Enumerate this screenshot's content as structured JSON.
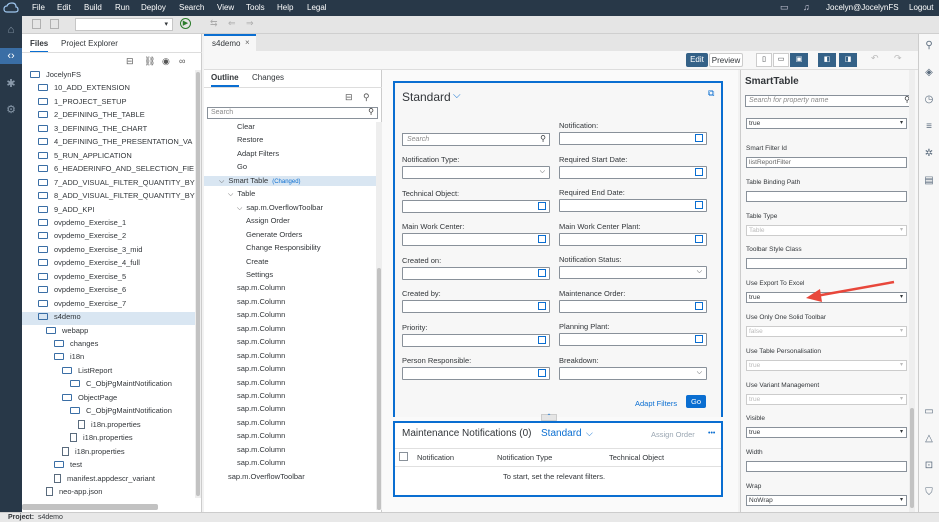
{
  "menubar": {
    "items": [
      "File",
      "Edit",
      "Build",
      "Run",
      "Deploy",
      "Search",
      "View",
      "Tools",
      "Help",
      "Legal"
    ],
    "user": "Jocelyn@JocelynFS",
    "logout": "Logout"
  },
  "files_panel": {
    "tabs": [
      "Files",
      "Project Explorer"
    ],
    "tree": [
      {
        "label": "JocelynFS",
        "level": 0,
        "kind": "folder"
      },
      {
        "label": "10_ADD_EXTENSION",
        "level": 1,
        "kind": "folder"
      },
      {
        "label": "1_PROJECT_SETUP",
        "level": 1,
        "kind": "folder"
      },
      {
        "label": "2_DEFINING_THE_TABLE",
        "level": 1,
        "kind": "folder"
      },
      {
        "label": "3_DEFINING_THE_CHART",
        "level": 1,
        "kind": "folder"
      },
      {
        "label": "4_DEFINING_THE_PRESENTATION_VA",
        "level": 1,
        "kind": "folder"
      },
      {
        "label": "5_RUN_APPLICATION",
        "level": 1,
        "kind": "folder"
      },
      {
        "label": "6_HEADERINFO_AND_SELECTION_FIE",
        "level": 1,
        "kind": "folder"
      },
      {
        "label": "7_ADD_VISUAL_FILTER_QUANTITY_BY",
        "level": 1,
        "kind": "folder"
      },
      {
        "label": "8_ADD_VISUAL_FILTER_QUANTITY_BY",
        "level": 1,
        "kind": "folder"
      },
      {
        "label": "9_ADD_KPI",
        "level": 1,
        "kind": "folder"
      },
      {
        "label": "ovpdemo_Exercise_1",
        "level": 1,
        "kind": "folder"
      },
      {
        "label": "ovpdemo_Exercise_2",
        "level": 1,
        "kind": "folder"
      },
      {
        "label": "ovpdemo_Exercise_3_mid",
        "level": 1,
        "kind": "folder"
      },
      {
        "label": "ovpdemo_Exercise_4_full",
        "level": 1,
        "kind": "folder"
      },
      {
        "label": "ovpdemo_Exercise_5",
        "level": 1,
        "kind": "folder"
      },
      {
        "label": "ovpdemo_Exercise_6",
        "level": 1,
        "kind": "folder"
      },
      {
        "label": "ovpdemo_Exercise_7",
        "level": 1,
        "kind": "folder"
      },
      {
        "label": "s4demo",
        "level": 1,
        "kind": "folder",
        "selected": true
      },
      {
        "label": "webapp",
        "level": 2,
        "kind": "folder"
      },
      {
        "label": "changes",
        "level": 3,
        "kind": "folder"
      },
      {
        "label": "i18n",
        "level": 3,
        "kind": "folder"
      },
      {
        "label": "ListReport",
        "level": 4,
        "kind": "folder"
      },
      {
        "label": "C_ObjPgMaintNotification",
        "level": 5,
        "kind": "folder"
      },
      {
        "label": "ObjectPage",
        "level": 4,
        "kind": "folder"
      },
      {
        "label": "C_ObjPgMaintNotification",
        "level": 5,
        "kind": "folder"
      },
      {
        "label": "i18n.properties",
        "level": 6,
        "kind": "file"
      },
      {
        "label": "i18n.properties",
        "level": 5,
        "kind": "file"
      },
      {
        "label": "i18n.properties",
        "level": 4,
        "kind": "file"
      },
      {
        "label": "test",
        "level": 3,
        "kind": "folder"
      },
      {
        "label": "manifest.appdescr_variant",
        "level": 3,
        "kind": "file"
      },
      {
        "label": "neo-app.json",
        "level": 2,
        "kind": "file"
      }
    ]
  },
  "editor": {
    "tab_label": "s4demo",
    "tab_close": "×",
    "edit_label": "Edit",
    "preview_label": "Preview"
  },
  "outline_panel": {
    "tabs": [
      "Outline",
      "Changes"
    ],
    "search_placeholder": "Search",
    "rows": [
      {
        "label": "Clear",
        "indent": 3
      },
      {
        "label": "Restore",
        "indent": 3
      },
      {
        "label": "Adapt Filters",
        "indent": 3
      },
      {
        "label": "Go",
        "indent": 3
      },
      {
        "label": "Smart Table",
        "indent": 1,
        "badge": "(Changed)",
        "expander": "v",
        "selected": true
      },
      {
        "label": "Table",
        "indent": 2,
        "expander": "v"
      },
      {
        "label": "sap.m.OverflowToolbar",
        "indent": 3,
        "expander": "v"
      },
      {
        "label": "Assign Order",
        "indent": 4
      },
      {
        "label": "Generate Orders",
        "indent": 4
      },
      {
        "label": "Change Responsibility",
        "indent": 4
      },
      {
        "label": "Create",
        "indent": 4
      },
      {
        "label": "Settings",
        "indent": 4
      },
      {
        "label": "sap.m.Column",
        "indent": 3
      },
      {
        "label": "sap.m.Column",
        "indent": 3
      },
      {
        "label": "sap.m.Column",
        "indent": 3
      },
      {
        "label": "sap.m.Column",
        "indent": 3
      },
      {
        "label": "sap.m.Column",
        "indent": 3
      },
      {
        "label": "sap.m.Column",
        "indent": 3
      },
      {
        "label": "sap.m.Column",
        "indent": 3
      },
      {
        "label": "sap.m.Column",
        "indent": 3
      },
      {
        "label": "sap.m.Column",
        "indent": 3
      },
      {
        "label": "sap.m.Column",
        "indent": 3
      },
      {
        "label": "sap.m.Column",
        "indent": 3
      },
      {
        "label": "sap.m.Column",
        "indent": 3
      },
      {
        "label": "sap.m.Column",
        "indent": 3
      },
      {
        "label": "sap.m.Column",
        "indent": 3
      },
      {
        "label": "sap.m.OverflowToolbar",
        "indent": 2
      }
    ]
  },
  "filter_bar": {
    "variant": "Standard",
    "search_placeholder": "Search",
    "left_fields": [
      {
        "label": "Notification Type:",
        "type": "dropdown"
      },
      {
        "label": "Technical Object:",
        "type": "valuehelp"
      },
      {
        "label": "Main Work Center:",
        "type": "valuehelp"
      },
      {
        "label": "Created on:",
        "type": "valuehelp"
      },
      {
        "label": "Created by:",
        "type": "valuehelp"
      },
      {
        "label": "Priority:",
        "type": "valuehelp"
      },
      {
        "label": "Person Responsible:",
        "type": "valuehelp"
      }
    ],
    "right_fields": [
      {
        "label": "Notification:",
        "type": "valuehelp"
      },
      {
        "label": "Required Start Date:",
        "type": "valuehelp"
      },
      {
        "label": "Required End Date:",
        "type": "valuehelp"
      },
      {
        "label": "Main Work Center Plant:",
        "type": "valuehelp"
      },
      {
        "label": "Notification Status:",
        "type": "dropdown"
      },
      {
        "label": "Maintenance Order:",
        "type": "valuehelp"
      },
      {
        "label": "Planning Plant:",
        "type": "valuehelp"
      },
      {
        "label": "Breakdown:",
        "type": "dropdown"
      }
    ],
    "adapt_filters": "Adapt Filters",
    "go": "Go"
  },
  "table": {
    "title": "Maintenance Notifications (0)",
    "variant": "Standard",
    "assign_order": "Assign Order",
    "more": "•••",
    "columns": [
      "Notification",
      "Notification Type",
      "Technical Object"
    ],
    "empty_text": "To start, set the relevant filters."
  },
  "properties": {
    "title": "SmartTable",
    "search_placeholder": "Search for property name",
    "first_value": "true",
    "items": [
      {
        "label": "Smart Filter Id",
        "value": "listReportFilter",
        "kind": "text"
      },
      {
        "label": "Table Binding Path",
        "value": "",
        "kind": "text"
      },
      {
        "label": "Table Type",
        "value": "Table",
        "kind": "dropdown",
        "disabled": true
      },
      {
        "label": "Toolbar Style Class",
        "value": "",
        "kind": "text"
      },
      {
        "label": "Use Export To Excel",
        "value": "true",
        "kind": "dropdown"
      },
      {
        "label": "Use Only One Solid Toolbar",
        "value": "false",
        "kind": "dropdown",
        "disabled": true
      },
      {
        "label": "Use Table Personalisation",
        "value": "true",
        "kind": "dropdown",
        "disabled": true
      },
      {
        "label": "Use Variant Management",
        "value": "true",
        "kind": "dropdown",
        "disabled": true
      },
      {
        "label": "Visible",
        "value": "true",
        "kind": "dropdown"
      },
      {
        "label": "Width",
        "value": "",
        "kind": "text"
      },
      {
        "label": "Wrap",
        "value": "NoWrap",
        "kind": "dropdown"
      }
    ]
  },
  "status": {
    "label": "Project:",
    "value": "s4demo"
  },
  "colors": {
    "accent": "#0a6ed1",
    "menubar": "#283848",
    "arrow": "#e8473b"
  }
}
